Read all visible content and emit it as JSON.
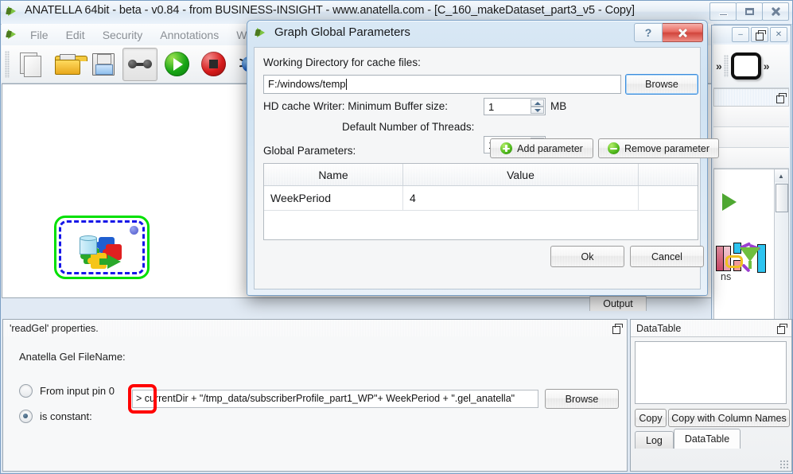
{
  "app": {
    "title": "ANATELLA 64bit - beta - v0.84 - from BUSINESS-INSIGHT - www.anatella.com - [C_160_makeDataset_part3_v5 - Copy]",
    "menu": [
      "File",
      "Edit",
      "Security",
      "Annotations",
      "Wind"
    ],
    "toolbar": [
      {
        "name": "new-document",
        "icon": "new-document-icon"
      },
      {
        "name": "open-file",
        "icon": "open-folder-icon"
      },
      {
        "name": "save-file",
        "icon": "floppy-save-icon"
      },
      {
        "name": "link-nodes",
        "icon": "link-icon"
      },
      {
        "name": "run-graph",
        "icon": "play-icon"
      },
      {
        "name": "stop-graph",
        "icon": "stop-icon"
      },
      {
        "name": "debug-graph",
        "icon": "bug-icon"
      }
    ],
    "caption_buttons": [
      "minimize",
      "maximize",
      "close"
    ],
    "overflow_chevron": "»"
  },
  "canvas": {
    "node_label": "",
    "node_icon": "gel-dataset-node-icon"
  },
  "mdi_child": {
    "caption_buttons": [
      "minimize",
      "restore",
      "close"
    ],
    "chevron_left": "»",
    "chevron_right": "»"
  },
  "right_tab_partial": "ns",
  "output_tab": {
    "label": "Output"
  },
  "properties": {
    "header_title": "'readGel' properties.",
    "field_label": "Anatella Gel FileName:",
    "options": [
      {
        "label": "From input pin 0",
        "checked": false
      },
      {
        "label": "is constant:",
        "checked": true
      }
    ],
    "constant_value": "> currentDir + \"/tmp_data/subscriberProfile_part1_WP\"+ WeekPeriod + \".gel_anatella\"",
    "browse_label": "Browse",
    "highlight_color": "#ff0000"
  },
  "datatable": {
    "header_title": "DataTable",
    "copy_label": "Copy",
    "copy_with_cols_label": "Copy with Column Names",
    "tabs": [
      {
        "label": "Log",
        "active": false
      },
      {
        "label": "DataTable",
        "active": true
      }
    ]
  },
  "dialog": {
    "title": "Graph Global Parameters",
    "help_glyph": "?",
    "working_dir_label": "Working Directory for cache files:",
    "working_dir_value": "F:/windows/temp",
    "working_dir_placeholder": "",
    "browse_label": "Browse",
    "hd_cache_label": "HD cache Writer:  Minimum Buffer size:",
    "hd_cache_value": "1",
    "hd_cache_unit": "MB",
    "threads_label": "Default Number of Threads:",
    "threads_value": "1",
    "global_params_label": "Global Parameters:",
    "add_param_label": "Add parameter",
    "remove_param_label": "Remove parameter",
    "table": {
      "columns": [
        "Name",
        "Value",
        ""
      ],
      "rows": [
        {
          "name": "WeekPeriod",
          "value": "4",
          "extra": ""
        }
      ]
    },
    "ok_label": "Ok",
    "cancel_label": "Cancel",
    "accent_close": "#d1453c"
  }
}
